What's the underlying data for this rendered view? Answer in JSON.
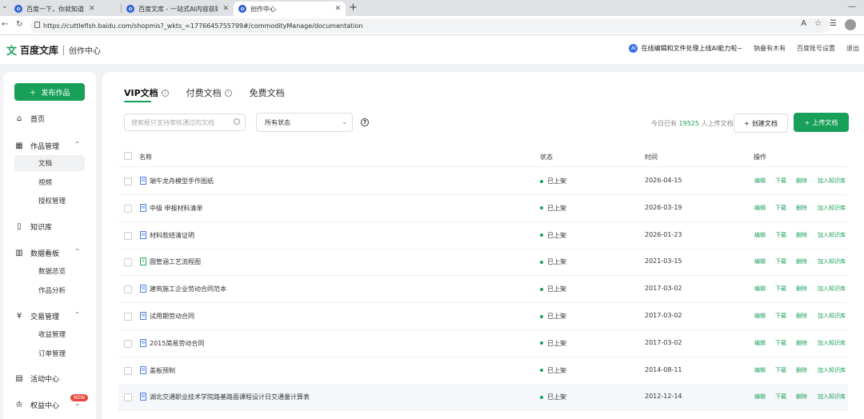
{
  "browser": {
    "tabs": [
      {
        "title": "百度一下，你就知道"
      },
      {
        "title": "百度文库 - 一站式AI内容获取和创作"
      },
      {
        "title": "创作中心"
      }
    ],
    "url": "https://cuttlefish.baidu.com/shopmis?_wkts_=1776645755799#/commodityManage/documentation"
  },
  "header": {
    "brand": "百度文库",
    "section": "创作中心",
    "ai_notice": "在线编辑和文件处理上线AI能力啦~",
    "user": "钠叠有木有",
    "settings": "百度账号设置",
    "logout": "退出"
  },
  "sidebar": {
    "publish": "发布作品",
    "home": "首页",
    "works": "作品管理",
    "works_sub": [
      "文档",
      "视频",
      "授权管理"
    ],
    "knowledge": "知识库",
    "data": "数据看板",
    "data_sub": [
      "数据总览",
      "作品分析"
    ],
    "trade": "交易管理",
    "trade_sub": [
      "收益管理",
      "订单管理"
    ],
    "activity": "活动中心",
    "rights": "权益中心",
    "new_badge": "NEW"
  },
  "main": {
    "tabs": [
      "VIP文档",
      "付费文档",
      "免费文档"
    ],
    "search_placeholder": "搜索框只支持审核通过的文档",
    "status_filter": "所有状态",
    "upload_prefix": "今日已有",
    "upload_count": "19525",
    "upload_suffix": "人上传文档",
    "create_btn": "创建文档",
    "upload_btn": "上传文档",
    "columns": {
      "name": "名称",
      "status": "状态",
      "time": "时间",
      "actions": "操作"
    },
    "actions": [
      "编辑",
      "下载",
      "删除",
      "加入知识库"
    ],
    "rows": [
      {
        "name": "端午龙舟模型手作图纸",
        "status": "已上架",
        "time": "2026-04-15",
        "type": "doc"
      },
      {
        "name": "中级 申报材料清单",
        "status": "已上架",
        "time": "2026-03-19",
        "type": "doc"
      },
      {
        "name": "材料款结清证明",
        "status": "已上架",
        "time": "2026-01-23",
        "type": "doc"
      },
      {
        "name": "圆管涵工艺流程图",
        "status": "已上架",
        "time": "2021-03-15",
        "type": "xls"
      },
      {
        "name": "建筑施工企业劳动合同范本",
        "status": "已上架",
        "time": "2017-03-02",
        "type": "doc"
      },
      {
        "name": "试用期劳动合同",
        "status": "已上架",
        "time": "2017-03-02",
        "type": "doc"
      },
      {
        "name": "2015简易劳动合同",
        "status": "已上架",
        "time": "2017-03-02",
        "type": "doc"
      },
      {
        "name": "盖板预制",
        "status": "已上架",
        "time": "2014-08-11",
        "type": "doc"
      },
      {
        "name": "湖北交通职业技术学院路基路面课程设计日交通量计算表",
        "status": "已上架",
        "time": "2012-12-14",
        "type": "doc"
      }
    ]
  }
}
